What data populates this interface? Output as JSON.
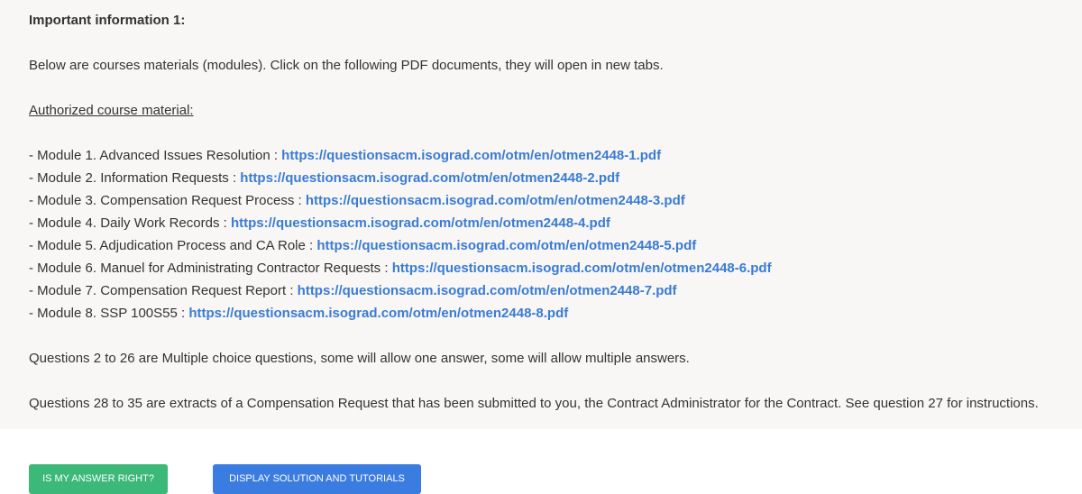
{
  "info": {
    "heading": "Important information 1:",
    "intro": "Below are courses materials (modules). Click on the following PDF documents, they will open in new tabs.",
    "authorized_label": "Authorized course material:",
    "modules": [
      {
        "label": "- Module 1. Advanced Issues Resolution : ",
        "url": "https://questionsacm.isograd.com/otm/en/otmen2448-1.pdf"
      },
      {
        "label": "- Module 2. Information Requests : ",
        "url": "https://questionsacm.isograd.com/otm/en/otmen2448-2.pdf"
      },
      {
        "label": "- Module 3. Compensation Request Process : ",
        "url": "https://questionsacm.isograd.com/otm/en/otmen2448-3.pdf"
      },
      {
        "label": "- Module 4. Daily Work Records : ",
        "url": "https://questionsacm.isograd.com/otm/en/otmen2448-4.pdf"
      },
      {
        "label": "- Module 5. Adjudication Process and CA Role : ",
        "url": "https://questionsacm.isograd.com/otm/en/otmen2448-5.pdf"
      },
      {
        "label": "- Module 6. Manuel for Administrating Contractor Requests : ",
        "url": "https://questionsacm.isograd.com/otm/en/otmen2448-6.pdf"
      },
      {
        "label": "- Module 7. Compensation Request Report : ",
        "url": "https://questionsacm.isograd.com/otm/en/otmen2448-7.pdf"
      },
      {
        "label": "- Module 8. SSP 100S55 : ",
        "url": "https://questionsacm.isograd.com/otm/en/otmen2448-8.pdf"
      }
    ],
    "note_questions_2_26": "Questions 2 to 26 are Multiple choice questions, some will allow one answer, some will allow multiple answers.",
    "note_questions_28_35": "Questions 28 to 35 are extracts of a Compensation Request that has been submitted to you, the Contract Administrator for the Contract. See question 27 for instructions."
  },
  "actions": {
    "check_answer_label": "IS MY ANSWER RIGHT?",
    "display_solution_label": "DISPLAY SOLUTION AND TUTORIALS"
  },
  "colors": {
    "panel_background": "#f8f7f5",
    "link": "#3a7bd5",
    "check_button": "#3cb878",
    "solution_button": "#3b7ce0"
  }
}
